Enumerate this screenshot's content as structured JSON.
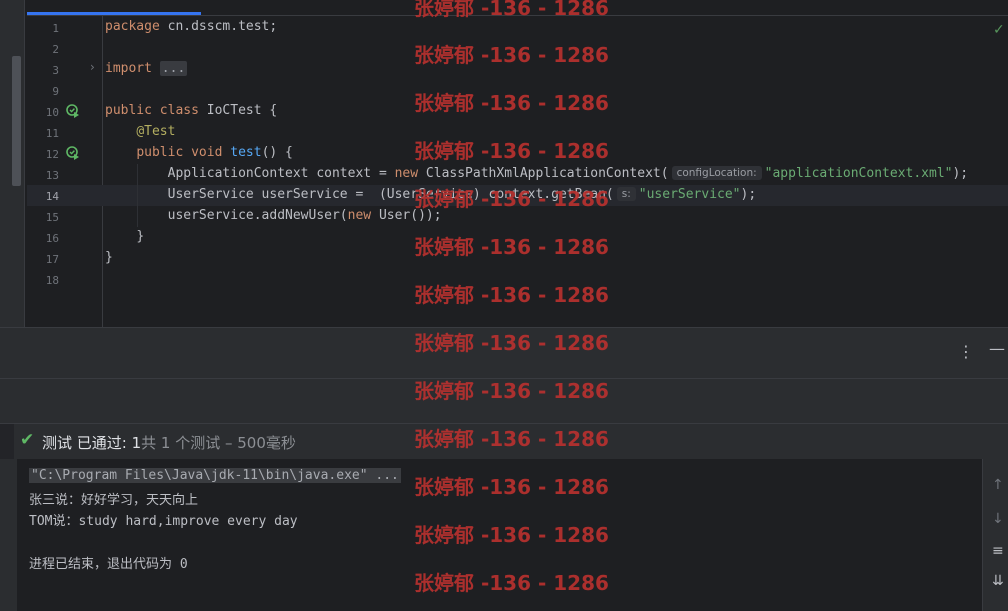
{
  "editor": {
    "lines": [
      {
        "num": "1",
        "text": "package cn.dsscm.test;"
      },
      {
        "num": "2",
        "text": ""
      },
      {
        "num": "3",
        "kw": "import ",
        "folded": "..."
      },
      {
        "num": "9",
        "text": ""
      },
      {
        "num": "10",
        "kw1": "public ",
        "kw2": "class ",
        "text": "IoCTest {"
      },
      {
        "num": "11",
        "ann": "@Test"
      },
      {
        "num": "12",
        "kw1": "public ",
        "kw2": "void ",
        "fn": "test",
        "text": "() {"
      },
      {
        "num": "13",
        "pre": "ApplicationContext context = ",
        "kw": "new ",
        "mid": "ClassPathXmlApplicationContext(",
        "hint": "configLocation:",
        "str": "\"applicationContext.xml\"",
        "post": ");"
      },
      {
        "num": "14",
        "pre": "UserService userService =  (UserService) context.getBean(",
        "hint": "s:",
        "str": "\"userService\"",
        "post": ");"
      },
      {
        "num": "15",
        "pre": "userService.addNewUser(",
        "kw": "new ",
        "post": "User());"
      },
      {
        "num": "16",
        "text": "}"
      },
      {
        "num": "17",
        "text": "}"
      },
      {
        "num": "18",
        "text": ""
      }
    ]
  },
  "test_run": {
    "status": "测试 已通过: 1",
    "summary": "共 1 个测试 – 500毫秒"
  },
  "console": {
    "command": "\"C:\\Program Files\\Java\\jdk-11\\bin\\java.exe\" ...",
    "output": [
      "张三说：好好学习，天天向上",
      "TOM说：study hard,improve every day",
      "",
      "进程已结束，退出代码为 0"
    ]
  },
  "watermark": "张婷郁 -136 - 1286",
  "icons": {
    "run": "run-gutter-icon",
    "fold": "fold-arrow-icon",
    "more": "more-vertical-icon",
    "minimize": "minimize-icon",
    "check": "check-icon",
    "up": "arrow-up-icon",
    "down": "arrow-down-icon",
    "wrap": "soft-wrap-icon",
    "scroll": "scroll-to-end-icon"
  },
  "colors": {
    "accent": "#3574f0",
    "pass": "#5fb865",
    "watermark": "#b8312f"
  }
}
